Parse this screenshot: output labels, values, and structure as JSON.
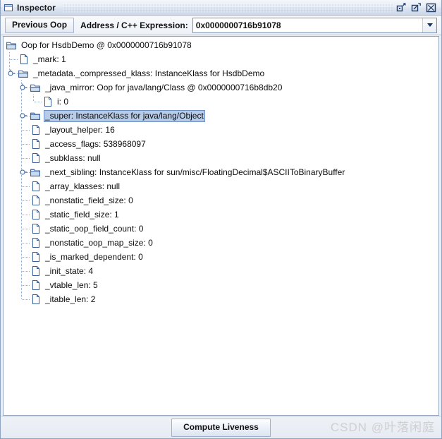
{
  "window": {
    "title": "Inspector",
    "icon": "window-icon",
    "buttons": [
      {
        "name": "minimize-button",
        "icon": "minimize-icon"
      },
      {
        "name": "maximize-button",
        "icon": "maximize-icon"
      },
      {
        "name": "close-button",
        "icon": "close-icon"
      }
    ]
  },
  "toolbar": {
    "previous_oop_label": "Previous Oop",
    "address_label": "Address / C++ Expression:",
    "address_value": "0x0000000716b91078",
    "address_placeholder": "",
    "dropdown_icon": "chevron-down-icon"
  },
  "tree": {
    "selected_index": 5,
    "rows": [
      {
        "depth": 0,
        "icon": "folder-open-icon",
        "handle": "none",
        "label": "Oop for HsdbDemo @ 0x0000000716b91078"
      },
      {
        "depth": 1,
        "icon": "document-icon",
        "handle": "none",
        "label": "_mark: 1"
      },
      {
        "depth": 1,
        "icon": "folder-open-icon",
        "handle": "expanded",
        "label": "_metadata._compressed_klass: InstanceKlass for HsdbDemo"
      },
      {
        "depth": 2,
        "icon": "folder-open-icon",
        "handle": "expanded",
        "label": "_java_mirror: Oop for java/lang/Class @ 0x0000000716b8db20"
      },
      {
        "depth": 3,
        "icon": "document-icon",
        "handle": "none",
        "label": "i: 0"
      },
      {
        "depth": 2,
        "icon": "folder-closed-icon",
        "handle": "collapsed",
        "label": "_super: InstanceKlass for java/lang/Object"
      },
      {
        "depth": 2,
        "icon": "document-icon",
        "handle": "none",
        "label": "_layout_helper: 16"
      },
      {
        "depth": 2,
        "icon": "document-icon",
        "handle": "none",
        "label": "_access_flags: 538968097"
      },
      {
        "depth": 2,
        "icon": "document-icon",
        "handle": "none",
        "label": "_subklass: null"
      },
      {
        "depth": 2,
        "icon": "folder-closed-icon",
        "handle": "collapsed",
        "label": "_next_sibling: InstanceKlass for sun/misc/FloatingDecimal$ASCIIToBinaryBuffer"
      },
      {
        "depth": 2,
        "icon": "document-icon",
        "handle": "none",
        "label": "_array_klasses: null"
      },
      {
        "depth": 2,
        "icon": "document-icon",
        "handle": "none",
        "label": "_nonstatic_field_size: 0"
      },
      {
        "depth": 2,
        "icon": "document-icon",
        "handle": "none",
        "label": "_static_field_size: 1"
      },
      {
        "depth": 2,
        "icon": "document-icon",
        "handle": "none",
        "label": "_static_oop_field_count: 0"
      },
      {
        "depth": 2,
        "icon": "document-icon",
        "handle": "none",
        "label": "_nonstatic_oop_map_size: 0"
      },
      {
        "depth": 2,
        "icon": "document-icon",
        "handle": "none",
        "label": "_is_marked_dependent: 0"
      },
      {
        "depth": 2,
        "icon": "document-icon",
        "handle": "none",
        "label": "_init_state: 4"
      },
      {
        "depth": 2,
        "icon": "document-icon",
        "handle": "none",
        "label": "_vtable_len: 5"
      },
      {
        "depth": 2,
        "icon": "document-icon",
        "handle": "none",
        "label": "_itable_len: 2"
      }
    ]
  },
  "bottom": {
    "compute_liveness_label": "Compute Liveness"
  },
  "watermark": {
    "text": "CSDN @叶落闲庭"
  },
  "colors": {
    "selection_fill": "#b6cbe8",
    "selection_border": "#6d8fc0",
    "icon_stroke": "#3a5f96",
    "icon_fill": "#c9dcf2",
    "titlebar_border": "#9fb2cd"
  }
}
